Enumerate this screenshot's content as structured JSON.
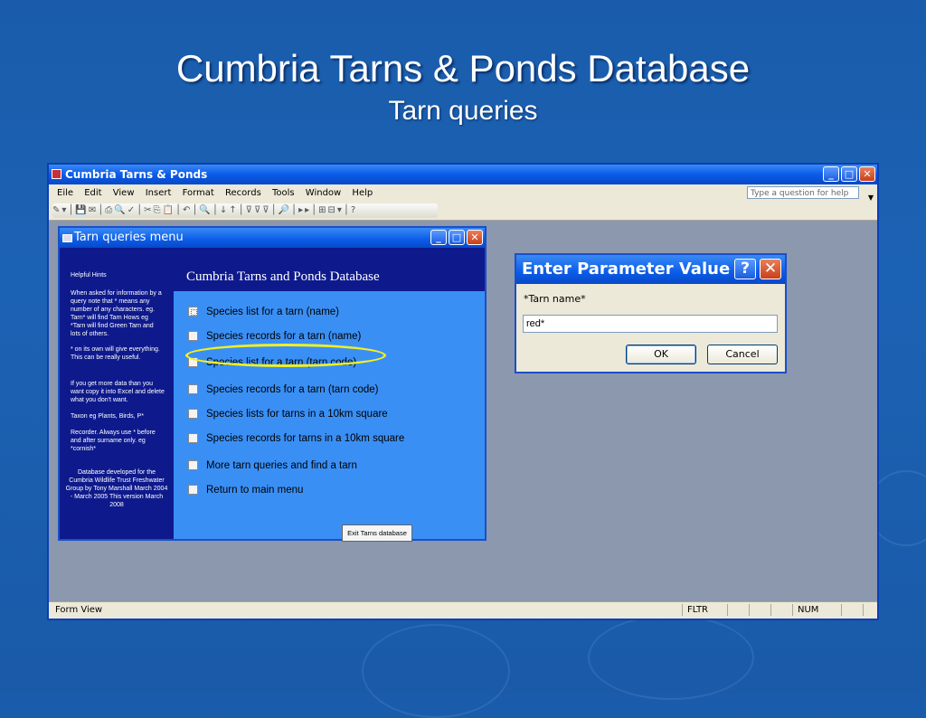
{
  "slide": {
    "title": "Cumbria Tarns & Ponds Database",
    "subtitle": "Tarn queries"
  },
  "app": {
    "title": "Cumbria Tarns & Ponds",
    "menu": [
      "Eile",
      "Edit",
      "View",
      "Insert",
      "Format",
      "Records",
      "Tools",
      "Window",
      "Help"
    ],
    "help_placeholder": "Type a question for help",
    "status": {
      "left": "Form View",
      "fltr": "FLTR",
      "num": "NUM"
    }
  },
  "form": {
    "title": "Tarn queries menu",
    "header": "Cumbria Tarns and Ponds Database",
    "hints": {
      "title": "Helpful Hints",
      "h1": "When asked for information by a query note that * means any number of any characters. eg. Tarn* will find Tarn Hows eg *Tarn will find Green Tarn and lots of others.",
      "h2": "* on its own will give everything. This can be really useful.",
      "h3": "If you get more data than you want copy it into Excel and delete what you don't want.",
      "h4": "Taxon eg Plants, Birds, P*",
      "h5": "Recorder. Always use * before and after surname only. eg *cornish*",
      "h6": "Database developed for the Cumbria Wildlife Trust Freshwater Group by Tony Marshall March 2004 - March 2005 This version March 2008"
    },
    "options": [
      "Species list for a tarn (name)",
      "Species records for a tarn (name)",
      "Species list for a tarn (tarn code)",
      "Species records for a tarn (tarn code)",
      "Species lists for tarns in a 10km square",
      "Species records for tarns in a 10km square",
      "More tarn queries and find a tarn",
      "Return to main menu"
    ],
    "exit_label": "Exit Tarns database"
  },
  "dialog": {
    "title": "Enter Parameter Value",
    "prompt": "*Tarn name*",
    "value": "red*",
    "ok": "OK",
    "cancel": "Cancel"
  }
}
